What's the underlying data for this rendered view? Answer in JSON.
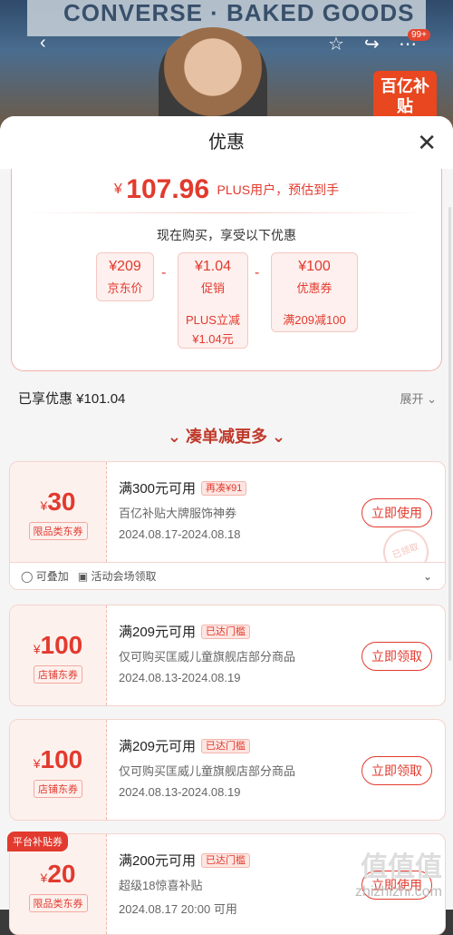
{
  "background": {
    "sign_text": "CONVERSE · BAKED GOODS",
    "badge": "百亿补贴",
    "cart_count": "99+"
  },
  "sheet": {
    "title": "优惠",
    "final_price": {
      "symbol": "¥",
      "value": "107.96",
      "tag": "PLUS用户，预估到手"
    },
    "subtitle": "现在购买，享受以下优惠",
    "calc": [
      {
        "amount": "¥209",
        "label": "京东价"
      },
      {
        "amount": "¥1.04",
        "label": "促销",
        "detail_1": "PLUS立减",
        "detail_2": "¥1.04元"
      },
      {
        "amount": "¥100",
        "label": "优惠券",
        "detail_1": "满209减100"
      }
    ],
    "ops": [
      "-",
      "-"
    ],
    "saved": "已享优惠 ¥101.04",
    "expand": "展开",
    "more_title": "凑单减更多"
  },
  "coupons": [
    {
      "sym": "¥",
      "amount": "30",
      "type": "限品类东券",
      "title": "满300元可用",
      "badge": "再凑¥91",
      "desc": "百亿补贴大牌服饰神券",
      "date": "2024.08.17-2024.08.18",
      "button": "立即使用",
      "stamp": "已领取",
      "foot_1": "可叠加",
      "foot_2": "活动会场领取"
    },
    {
      "sym": "¥",
      "amount": "100",
      "type": "店铺东券",
      "title": "满209元可用",
      "badge": "已达门槛",
      "desc": "仅可购买匡威儿童旗舰店部分商品",
      "date": "2024.08.13-2024.08.19",
      "button": "立即领取"
    },
    {
      "sym": "¥",
      "amount": "100",
      "type": "店铺东券",
      "title": "满209元可用",
      "badge": "已达门槛",
      "desc": "仅可购买匡威儿童旗舰店部分商品",
      "date": "2024.08.13-2024.08.19",
      "button": "立即领取"
    },
    {
      "sym": "¥",
      "amount": "20",
      "type": "限品类东券",
      "title": "满200元可用",
      "badge": "已达门槛",
      "desc": "超级18惊喜补贴",
      "date": "2024.08.17 20:00 可用",
      "button": "立即使用",
      "corner": "平台补贴券"
    }
  ],
  "watermark": {
    "big": "值值值",
    "small": "zhizhizhi.com"
  }
}
